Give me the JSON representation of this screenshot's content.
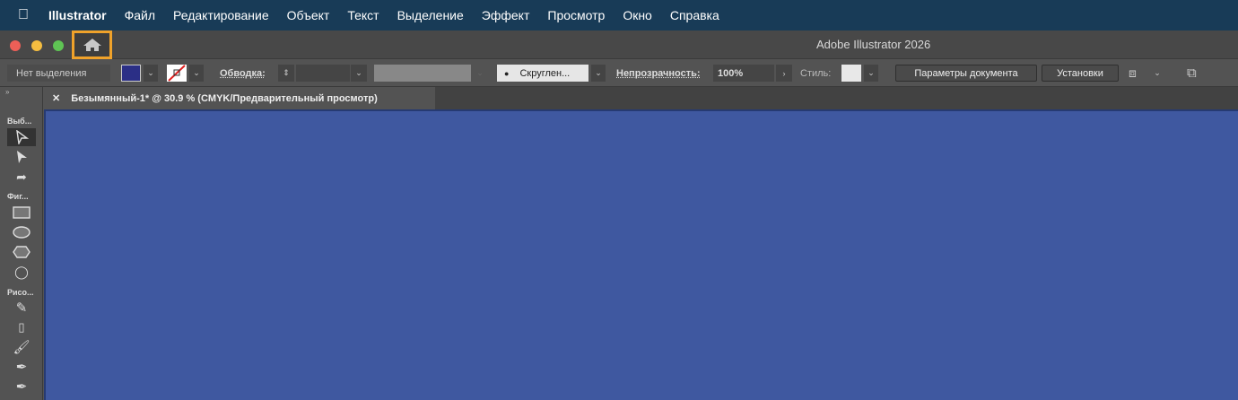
{
  "menubar": {
    "app": "Illustrator",
    "items": [
      "Файл",
      "Редактирование",
      "Объект",
      "Текст",
      "Выделение",
      "Эффект",
      "Просмотр",
      "Окно",
      "Справка"
    ]
  },
  "window": {
    "title": "Adobe Illustrator 2026"
  },
  "control": {
    "selection": "Нет выделения",
    "fill_color": "#2b2f86",
    "stroke_label": "Обводка:",
    "brush": "Скруглен...",
    "opacity_label": "Непрозрачность:",
    "opacity": "100%",
    "style_label": "Стиль:",
    "doc_setup": "Параметры документа",
    "prefs": "Установки"
  },
  "tab": {
    "title": "Безымянный-1* @ 30.9 % (CMYK/Предварительный просмотр)"
  },
  "tools": {
    "groups": [
      "Выб...",
      "Фиг...",
      "Рисо..."
    ]
  },
  "colors": {
    "canvas": "#3f58a0",
    "highlight": "#f0a22a"
  }
}
